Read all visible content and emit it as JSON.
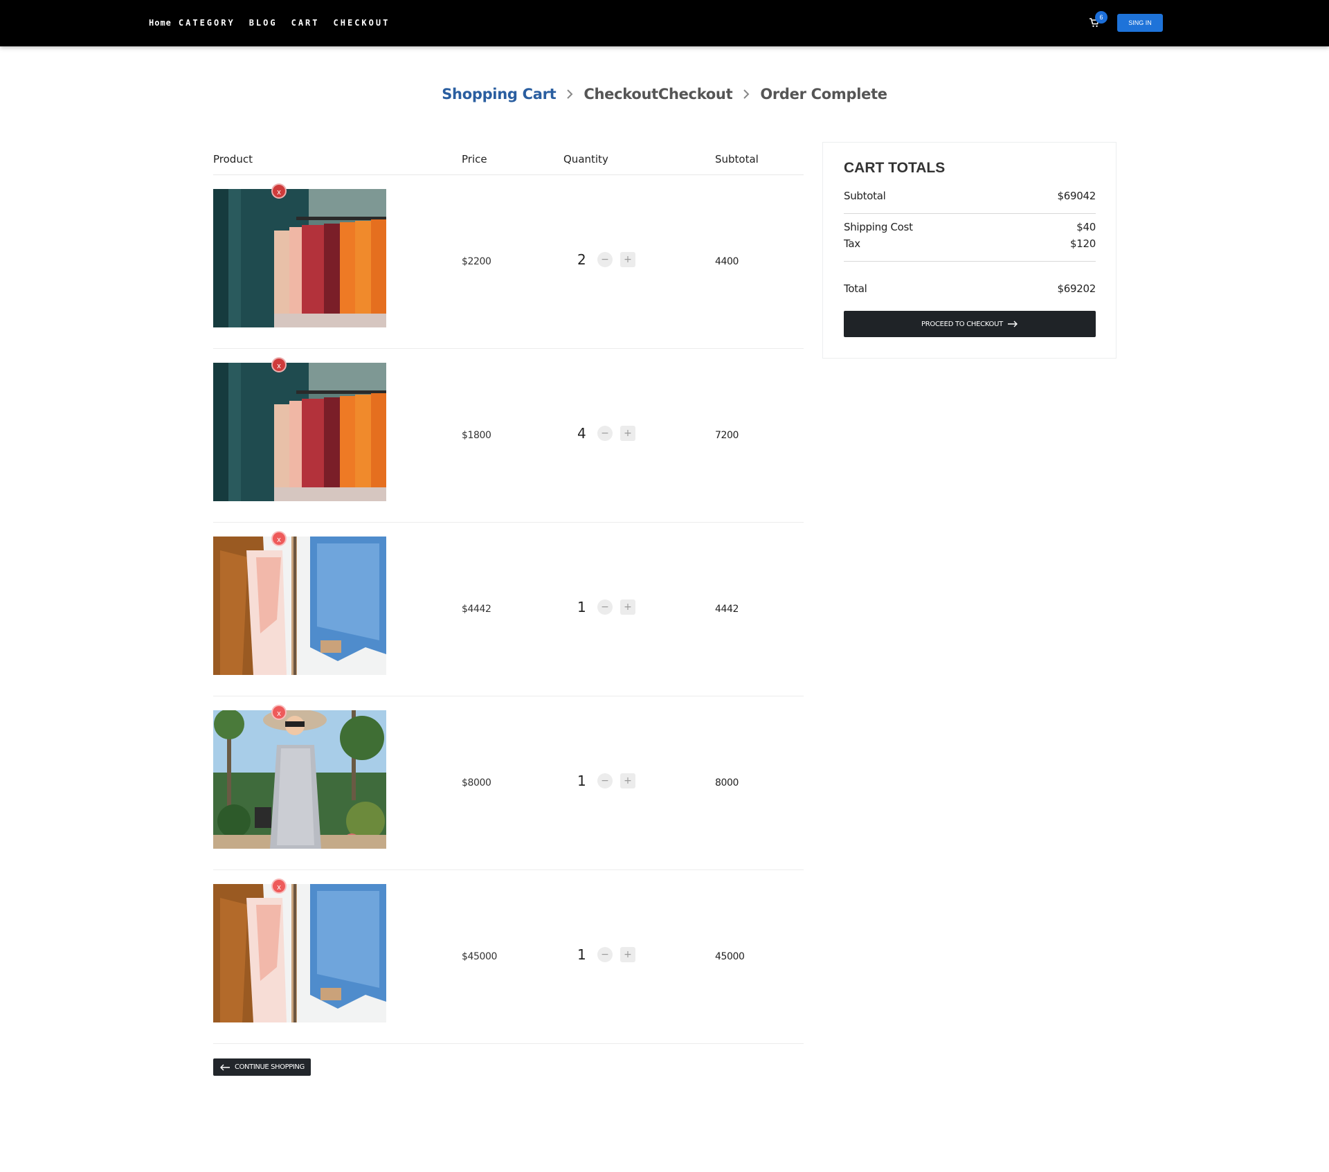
{
  "nav": {
    "links": [
      "Home",
      "CATEGORY",
      "BLOG",
      "CART",
      "CHECKOUT"
    ],
    "cart_count": "6",
    "signin_label": "SING IN",
    "accent_color": "#1e73d9"
  },
  "steps": [
    "Shopping Cart",
    "CheckoutCheckout",
    "Order Complete"
  ],
  "table": {
    "headers": [
      "Product",
      "Price",
      "Quantity",
      "Subtotal"
    ],
    "rows": [
      {
        "image": "clothes-rack",
        "remove": "x",
        "price": "$2200",
        "qty": "2",
        "minus": "−",
        "plus": "+",
        "subtotal": "4400"
      },
      {
        "image": "clothes-rack",
        "remove": "x",
        "price": "$1800",
        "qty": "4",
        "minus": "−",
        "plus": "+",
        "subtotal": "7200"
      },
      {
        "image": "jacket-shirt-jeans",
        "remove": "x",
        "price": "$4442",
        "qty": "1",
        "minus": "−",
        "plus": "+",
        "subtotal": "4442"
      },
      {
        "image": "woman-in-dress",
        "remove": "x",
        "price": "$8000",
        "qty": "1",
        "minus": "−",
        "plus": "+",
        "subtotal": "8000"
      },
      {
        "image": "jacket-shirt-jeans",
        "remove": "x",
        "price": "$45000",
        "qty": "1",
        "minus": "−",
        "plus": "+",
        "subtotal": "45000"
      }
    ]
  },
  "continue_label": "CONTINUE SHOPPING",
  "totals": {
    "title": "CART TOTALS",
    "subtotal_label": "Subtotal",
    "subtotal_value": "$69042",
    "shipping_label": "Shipping Cost",
    "shipping_value": "$40",
    "tax_label": "Tax",
    "tax_value": "$120",
    "total_label": "Total",
    "total_value": "$69202",
    "checkout_label": "PROCEED TO CHECKOUT"
  }
}
